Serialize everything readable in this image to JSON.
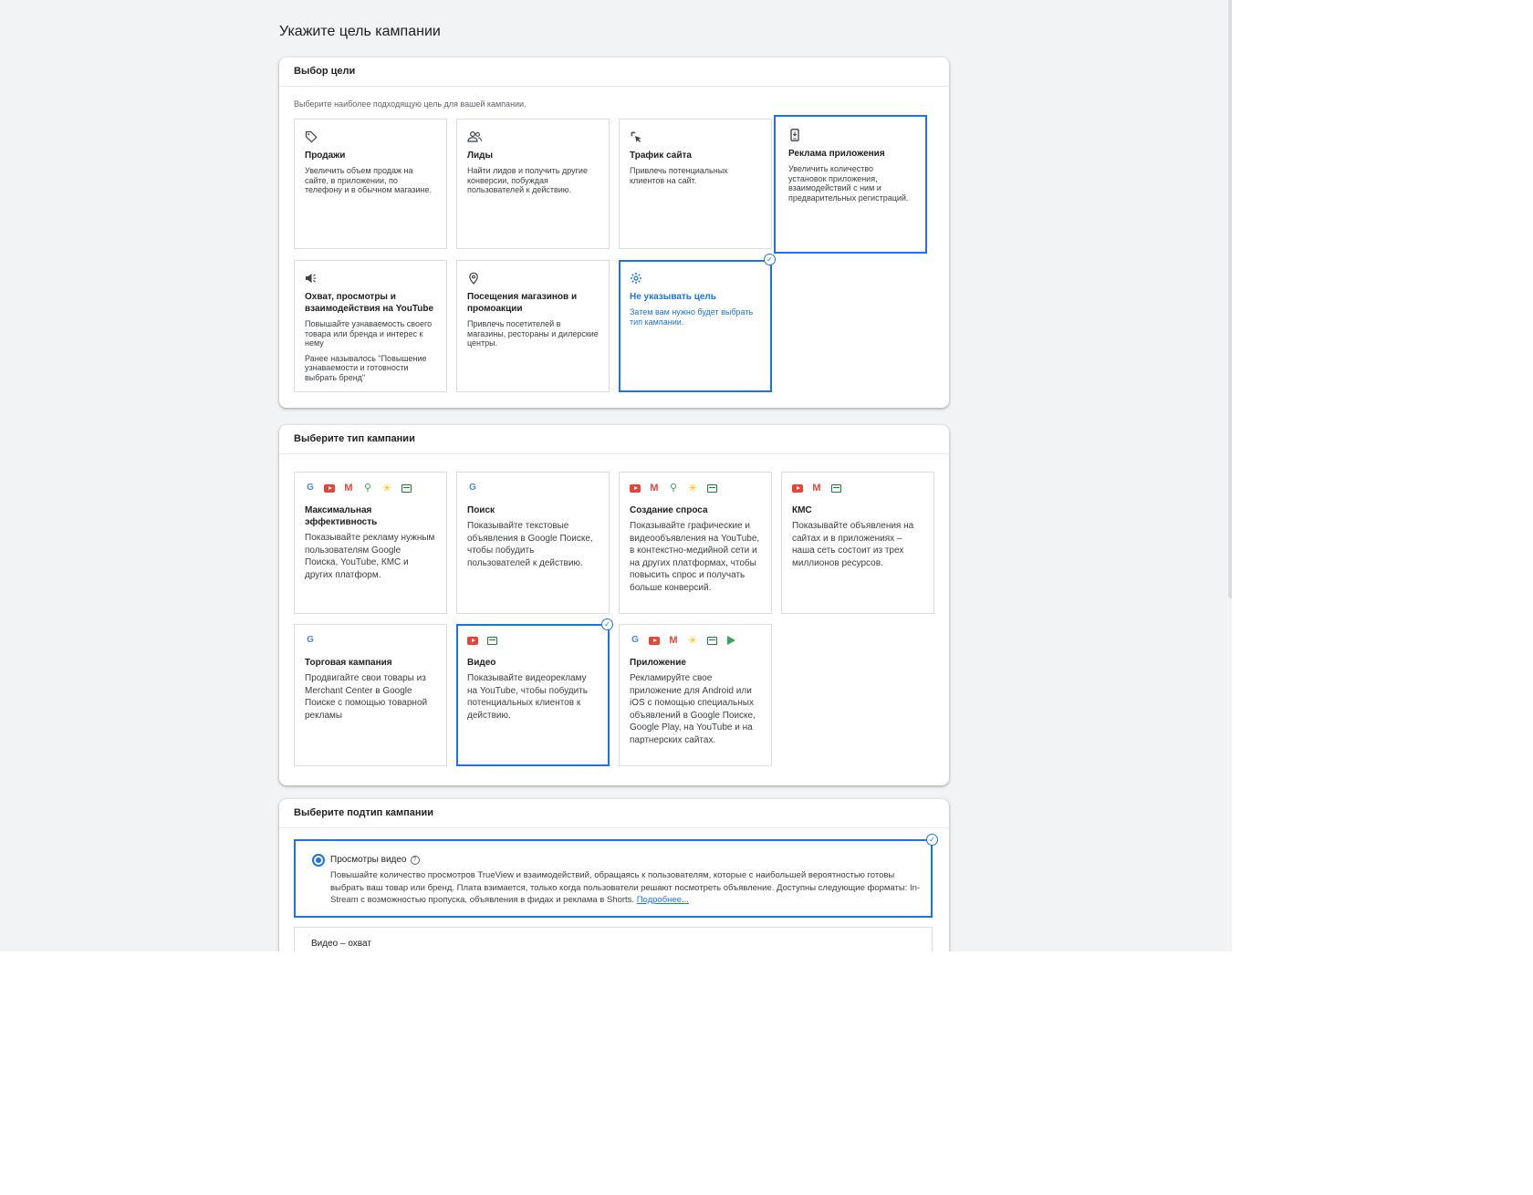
{
  "page": {
    "title": "Укажите цель кампании"
  },
  "goal_section": {
    "header": "Выбор цели",
    "subtitle": "Выберите наиболее подходящую цель для вашей кампании.",
    "tiles": [
      {
        "icon": "tag-icon",
        "title": "Продажи",
        "desc": "Увеличить объем продаж на сайте, в приложении, по телефону и в обычном магазине."
      },
      {
        "icon": "people-icon",
        "title": "Лиды",
        "desc": "Найти лидов и получить другие конверсии, побуждая пользователей к действию."
      },
      {
        "icon": "cursor-click-icon",
        "title": "Трафик сайта",
        "desc": "Привлечь потенциальных клиентов на сайт."
      },
      {
        "icon": "phone-download-icon",
        "title": "Реклама приложения",
        "desc": "Увеличить количество установок приложения, взаимодействий с ним и предварительных регистраций."
      },
      {
        "icon": "megaphone-icon",
        "title": "Охват, просмотры и взаимодействия на YouTube",
        "desc": "Повышайте узнаваемость своего товара или бренда и интерес к нему",
        "note": "Ранее называлось \"Повышение узнаваемости и готовности выбрать бренд\""
      },
      {
        "icon": "location-pin-icon",
        "title": "Посещения магазинов и промоакции",
        "desc": "Привлечь посетителей в магазины, рестораны и дилерские центры."
      },
      {
        "icon": "gear-icon",
        "title": "Не указывать цель",
        "desc": "Затем вам нужно будет выбрать тип кампании."
      }
    ]
  },
  "type_section": {
    "header": "Выберите тип кампании",
    "tiles": [
      {
        "title": "Максимальная эффективность",
        "desc": "Показывайте рекламу нужным пользователям Google Поиска, YouTube, КМС и других платформ."
      },
      {
        "title": "Поиск",
        "desc": "Показывайте текстовые объявления в Google Поиске, чтобы побудить пользователей к действию."
      },
      {
        "title": "Создание спроса",
        "desc": "Показывайте графические и видеообъявления на YouTube, в контекстно-медийной сети и на других платформах, чтобы повысить спрос и получать больше конверсий."
      },
      {
        "title": "КМС",
        "desc": "Показывайте объявления на сайтах и в приложениях – наша сеть состоит из трех миллионов ресурсов."
      },
      {
        "title": "Торговая кампания",
        "desc": "Продвигайте свои товары из Merchant Center в Google Поиске с помощью товарной рекламы"
      },
      {
        "title": "Видео",
        "desc": "Показывайте видеорекламу на YouTube, чтобы побудить потенциальных клиентов к действию."
      },
      {
        "title": "Приложение",
        "desc": "Рекламируйте свое приложение для Android или iOS с помощью специальных объявлений в Google Поиске, Google Play, на YouTube и на партнерских сайтах."
      }
    ]
  },
  "subtype_section": {
    "header": "Выберите подтип кампании",
    "options": [
      {
        "title": "Просмотры видео",
        "help": "?",
        "desc": "Повышайте количество просмотров TrueView и взаимодействий, обращаясь к пользователям, которые с наибольшей вероятностью готовы выбрать ваш товар или бренд. Плата взимается, только когда пользователи решают посмотреть объявление. Доступны следующие форматы: In-Stream с возможностью пропуска, объявления в фидах и реклама в Shorts.",
        "learn_more": "Подробнее..."
      },
      {
        "title": "Видео – охват"
      }
    ]
  },
  "icons": {
    "google": "G",
    "gmail": "M",
    "maps": "⚲",
    "discover": "✳",
    "check": "✓"
  },
  "colors": {
    "accent": "#1a73e8",
    "background": "#f1f3f4"
  }
}
